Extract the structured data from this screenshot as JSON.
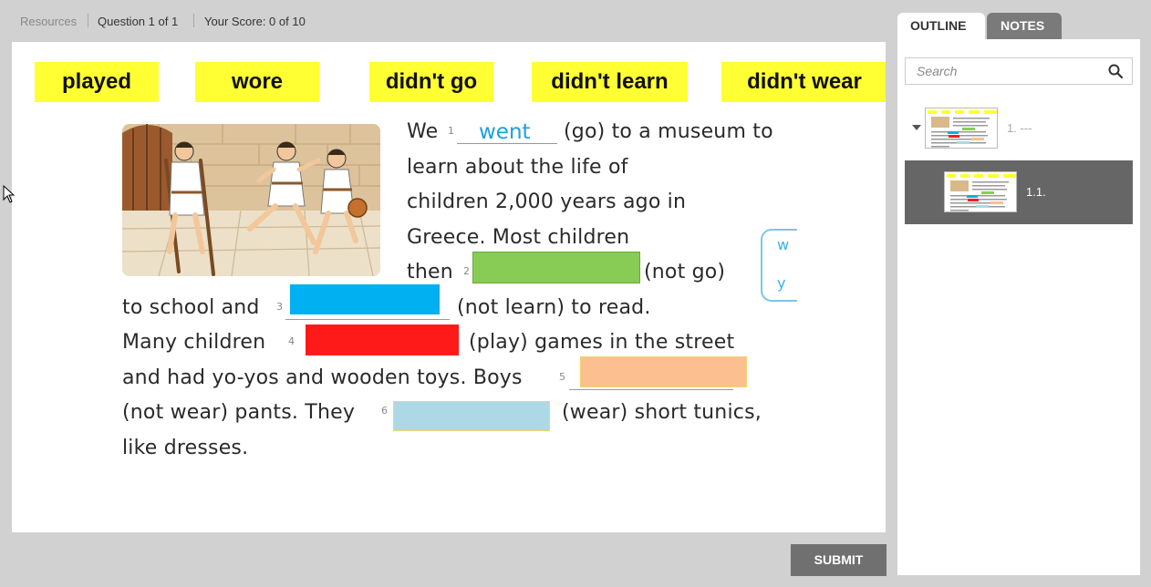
{
  "topbar": {
    "resources": "Resources",
    "question": "Question 1 of 1",
    "score": "Your Score: 0 of 10"
  },
  "word_bank": [
    "played",
    "wore",
    "didn't go",
    "didn't learn",
    "didn't wear"
  ],
  "text": {
    "l1a": "We",
    "l1b": "(go) to a museum to",
    "answer1": "went",
    "l2": "learn about the life of",
    "l3": "children 2,000 years ago in",
    "l4": "Greece. Most children",
    "l5a": "then",
    "l5b": "(not go)",
    "l6a": "to school and",
    "l6b": "(not learn) to read.",
    "l7a": "Many children",
    "l7b": "(play) games in the street",
    "l8a": "and had yo-yos and wooden toys. Boys",
    "l9a": "(not  wear) pants. They",
    "l9b": "(wear) short tunics,",
    "l10": "like dresses.",
    "n1": "1",
    "n2": "2",
    "n3": "3",
    "n4": "4",
    "n5": "5",
    "n6": "6",
    "bubble1": "w",
    "bubble2": "y"
  },
  "drop_colors": [
    "#88cc55",
    "#00b0f0",
    "#ff1a1a",
    "#fbbf90",
    "#add8e6"
  ],
  "submit": "SUBMIT",
  "panel": {
    "tab_outline": "OUTLINE",
    "tab_notes": "NOTES",
    "search_placeholder": "Search",
    "item1": "1. ---",
    "item2": "1.1."
  }
}
